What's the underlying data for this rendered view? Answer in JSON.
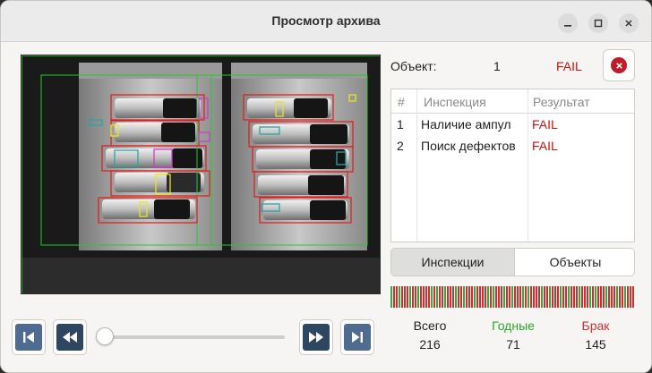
{
  "window": {
    "title": "Просмотр архива",
    "controls": [
      "minimize-icon",
      "maximize-icon",
      "close-icon"
    ]
  },
  "object": {
    "label": "Объект:",
    "number": "1",
    "result": "FAIL",
    "result_color": "#d01010"
  },
  "inspections_table": {
    "headers": [
      "#",
      "Инспекция",
      "Результат"
    ],
    "rows": [
      {
        "num": "1",
        "name": "Наличие ампул",
        "result": "FAIL"
      },
      {
        "num": "2",
        "name": "Поиск дефектов",
        "result": "FAIL"
      }
    ]
  },
  "tabs": [
    {
      "label": "Инспекции",
      "active": true
    },
    {
      "label": "Объекты",
      "active": false
    }
  ],
  "stats": {
    "total": {
      "label": "Всего",
      "value": "216",
      "color": "#222222"
    },
    "good": {
      "label": "Годные",
      "value": "71",
      "color": "#2aa52a"
    },
    "reject": {
      "label": "Брак",
      "value": "145",
      "color": "#d03030"
    }
  },
  "timeline": {
    "good_color": "#3da53d",
    "reject_color": "#c93030",
    "position": 0
  },
  "navigation": {
    "icons": [
      "skip-to-start-icon",
      "rewind-icon",
      "fast-forward-icon",
      "skip-to-end-icon"
    ]
  },
  "colors": {
    "accent_dark": "#2f4660",
    "accent": "#4f6b8f",
    "fail": "#d01010"
  }
}
